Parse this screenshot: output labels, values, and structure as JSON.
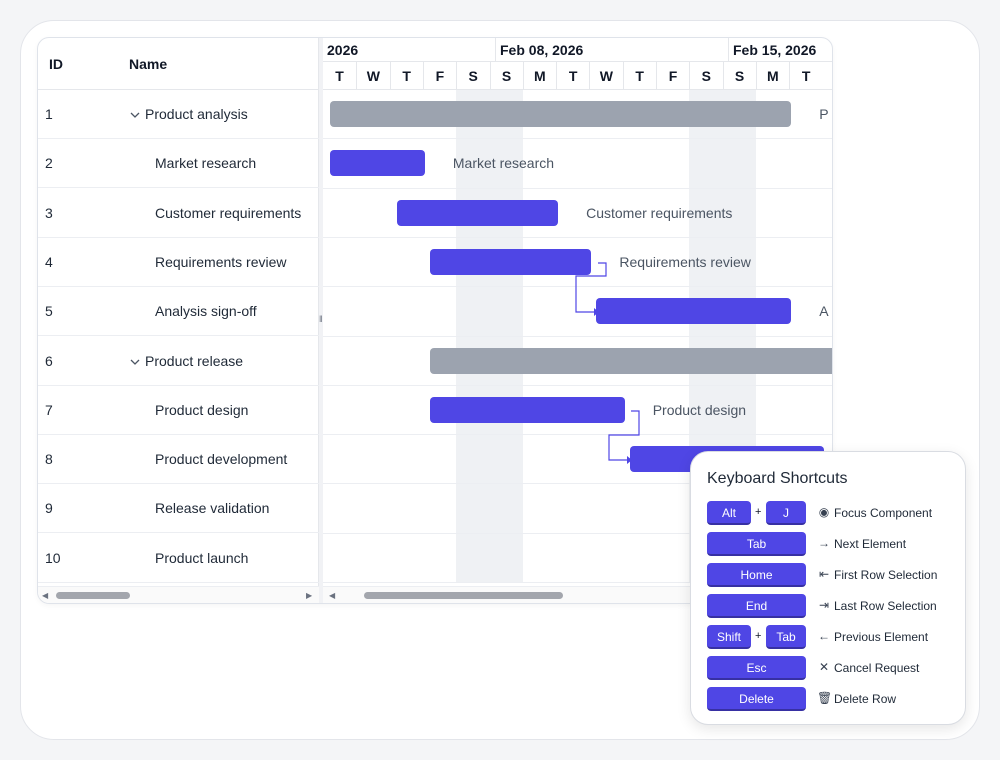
{
  "grid": {
    "columns": {
      "id": "ID",
      "name": "Name"
    },
    "rows": [
      {
        "id": "1",
        "name": "Product analysis",
        "parent": true
      },
      {
        "id": "2",
        "name": "Market research",
        "parent": false
      },
      {
        "id": "3",
        "name": "Customer requirements",
        "parent": false
      },
      {
        "id": "4",
        "name": "Requirements review",
        "parent": false
      },
      {
        "id": "5",
        "name": "Analysis sign-off",
        "parent": false
      },
      {
        "id": "6",
        "name": "Product release",
        "parent": true
      },
      {
        "id": "7",
        "name": "Product design",
        "parent": false
      },
      {
        "id": "8",
        "name": "Product development",
        "parent": false
      },
      {
        "id": "9",
        "name": "Release validation",
        "parent": false
      },
      {
        "id": "10",
        "name": "Product launch",
        "parent": false
      }
    ]
  },
  "timeline": {
    "weeks": [
      "2026",
      "Feb 08, 2026",
      "Feb 15, 2026"
    ],
    "days": [
      "T",
      "W",
      "T",
      "F",
      "S",
      "S",
      "M",
      "T",
      "W",
      "T",
      "F",
      "S",
      "S",
      "M",
      "T"
    ]
  },
  "bars": [
    {
      "row": 0,
      "start": 0,
      "days": 14,
      "type": "summary",
      "label": "P"
    },
    {
      "row": 1,
      "start": 0,
      "days": 3,
      "type": "task",
      "label": "Market research"
    },
    {
      "row": 2,
      "start": 2,
      "days": 5,
      "type": "task",
      "label": "Customer requirements"
    },
    {
      "row": 3,
      "start": 3,
      "days": 5,
      "type": "task",
      "label": "Requirements review"
    },
    {
      "row": 4,
      "start": 8,
      "days": 6,
      "type": "task",
      "label": "A"
    },
    {
      "row": 5,
      "start": 3,
      "days": 13,
      "type": "summary",
      "label": ""
    },
    {
      "row": 6,
      "start": 3,
      "days": 6,
      "type": "task",
      "label": "Product design"
    },
    {
      "row": 7,
      "start": 9,
      "days": 6,
      "type": "task",
      "label": ""
    }
  ],
  "shortcuts": {
    "title": "Keyboard Shortcuts",
    "items": [
      {
        "keys": [
          "Alt",
          "J"
        ],
        "icon": "focus-icon",
        "glyph": "◉",
        "desc": "Focus Component"
      },
      {
        "keys": [
          "Tab"
        ],
        "icon": "arrow-right-icon",
        "glyph": "→",
        "desc": "Next Element"
      },
      {
        "keys": [
          "Home"
        ],
        "icon": "first-row-icon",
        "glyph": "⇤",
        "desc": "First Row Selection"
      },
      {
        "keys": [
          "End"
        ],
        "icon": "last-row-icon",
        "glyph": "⇥",
        "desc": "Last Row Selection"
      },
      {
        "keys": [
          "Shift",
          "Tab"
        ],
        "icon": "arrow-left-icon",
        "glyph": "←",
        "desc": "Previous Element"
      },
      {
        "keys": [
          "Esc"
        ],
        "icon": "close-icon",
        "glyph": "✕",
        "desc": "Cancel Request"
      },
      {
        "keys": [
          "Delete"
        ],
        "icon": "trash-icon",
        "glyph": "🗑",
        "desc": "Delete Row"
      }
    ]
  },
  "colors": {
    "task": "#4f46e5",
    "summary": "#9ca3af",
    "connector": "#4f46e5"
  }
}
